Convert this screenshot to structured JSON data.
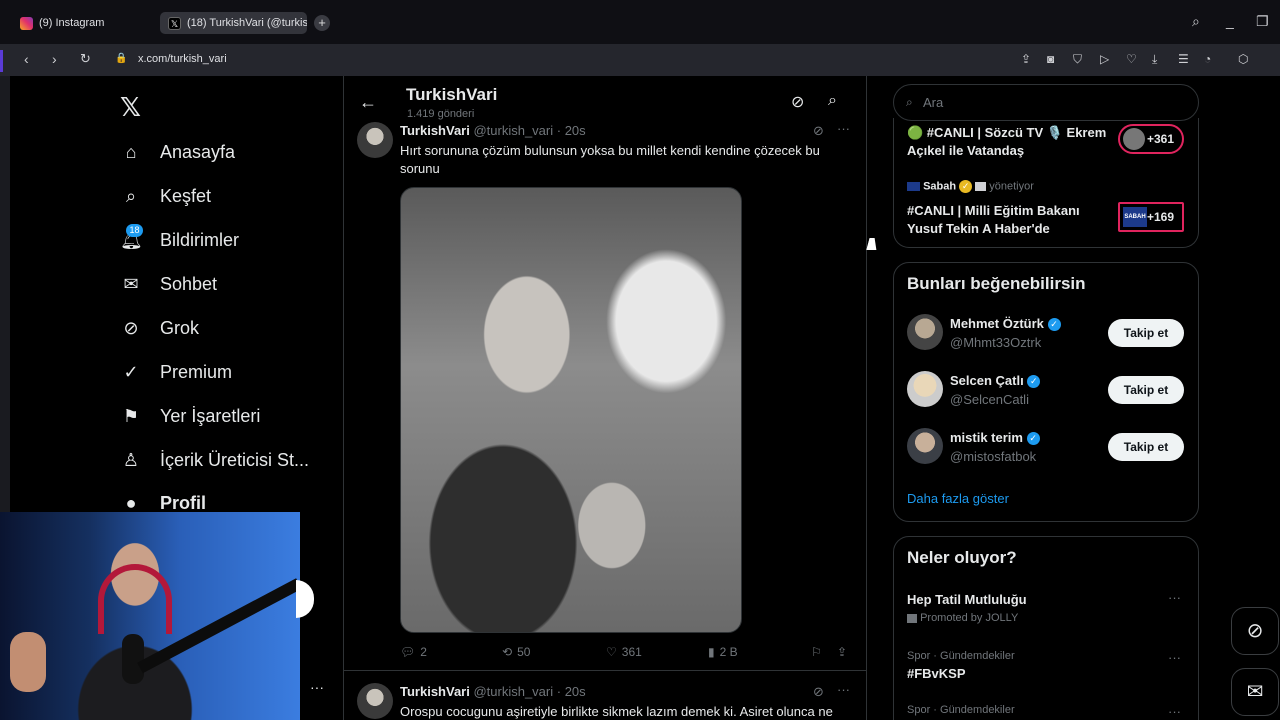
{
  "browser": {
    "tabs": [
      {
        "label": "(9) Instagram"
      },
      {
        "label": "(18) TurkishVari (@turkish"
      }
    ],
    "url": "x.com/turkish_vari"
  },
  "nav": {
    "items": [
      {
        "label": "Anasayfa",
        "icon": "home-icon"
      },
      {
        "label": "Keşfet",
        "icon": "search-icon"
      },
      {
        "label": "Bildirimler",
        "icon": "bell-icon"
      },
      {
        "label": "Sohbet",
        "icon": "envelope-icon"
      },
      {
        "label": "Grok",
        "icon": "grok-icon"
      },
      {
        "label": "Premium",
        "icon": "premium-icon"
      },
      {
        "label": "Yer İşaretleri",
        "icon": "bookmark-icon"
      },
      {
        "label": "İçerik Üreticisi St...",
        "icon": "creator-icon"
      },
      {
        "label": "Profil",
        "icon": "profile-icon"
      }
    ],
    "notif_badge": "18"
  },
  "profile_header": {
    "name": "TurkishVari",
    "posts": "1.419 gönderi"
  },
  "tweets": [
    {
      "name": "TurkishVari",
      "handle": "@turkish_vari",
      "time": "· 20s",
      "text": "Hırt sorununa çözüm bulunsun yoksa bu millet kendi kendine çözecek bu sorunu",
      "replies": "2",
      "retweets": "50",
      "likes": "361",
      "views": "2 B"
    },
    {
      "name": "TurkishVari",
      "handle": "@turkish_vari",
      "time": "· 20s",
      "text": "Orospu cocugunu aşiretiyle birlikte sikmek lazım demek ki. Asiret olunca ne"
    }
  ],
  "search": {
    "placeholder": "Ara"
  },
  "live": [
    {
      "title": "🟢 #CANLI | Sözcü TV 🎙️ Ekrem Açıkel ile Vatandaş",
      "count": "+361"
    },
    {
      "source": "Sabah",
      "role": "yönetiyor",
      "title": "#CANLI | Milli Eğitim Bakanı Yusuf Tekin A Haber'de",
      "count": "+169",
      "thumb": "SABAH"
    }
  ],
  "who_to_follow": {
    "title": "Bunları beğenebilirsin",
    "users": [
      {
        "name": "Mehmet Öztürk",
        "handle": "@Mhmt33Oztrk",
        "button": "Takip et"
      },
      {
        "name": "Selcen Çatlı",
        "handle": "@SelcenCatli",
        "button": "Takip et"
      },
      {
        "name": "mistik terim",
        "handle": "@mistosfatbok",
        "button": "Takip et"
      }
    ],
    "show_more": "Daha fazla göster"
  },
  "trends": {
    "title": "Neler oluyor?",
    "items": [
      {
        "meta": "",
        "name": "Hep Tatil Mutluluğu",
        "promo": "Promoted by JOLLY"
      },
      {
        "meta": "Spor · Gündemdekiler",
        "name": "#FBvKSP"
      },
      {
        "meta": "Spor · Gündemdekiler",
        "name": ""
      }
    ]
  },
  "colors": {
    "accent": "#1d9bf0",
    "live_border": "#e0245e",
    "background": "#000000"
  }
}
